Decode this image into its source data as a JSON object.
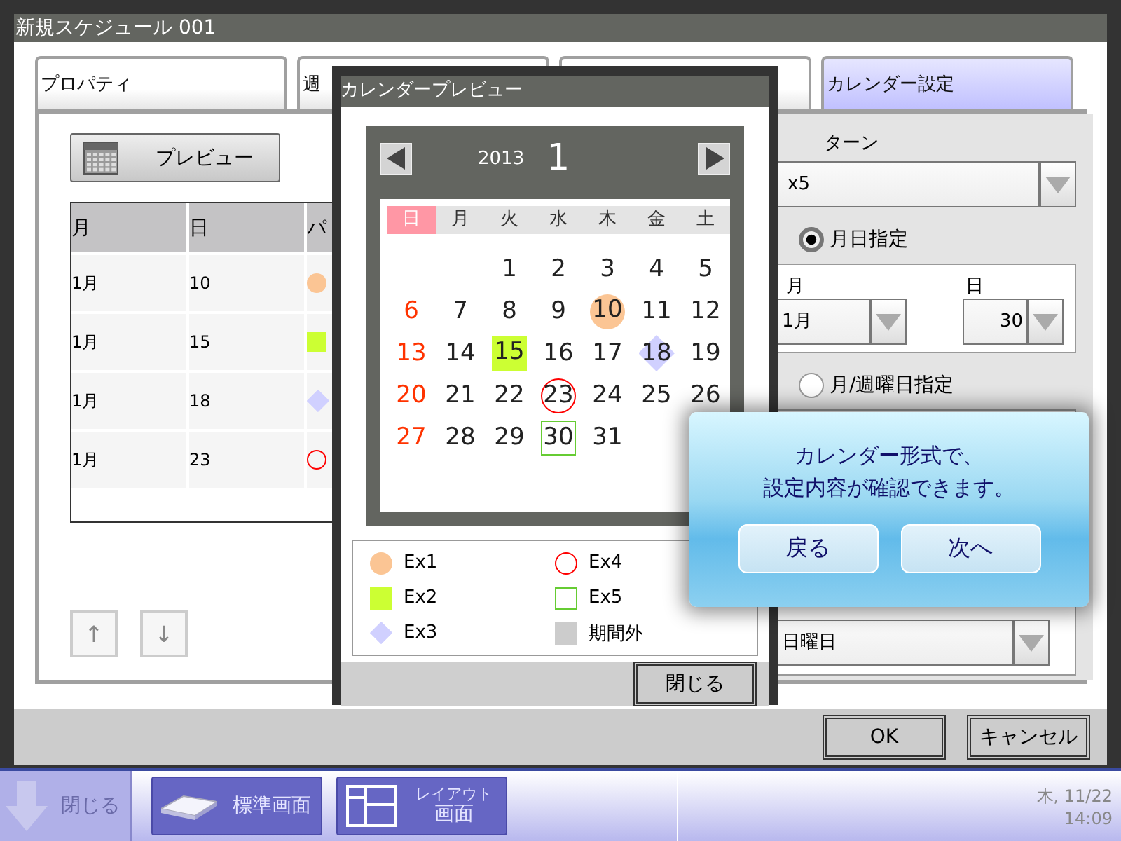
{
  "window": {
    "title": "新規スケジュール 001"
  },
  "tabs": [
    {
      "label": "プロパティ",
      "selected": false
    },
    {
      "label": "週",
      "selected": false
    },
    {
      "selected": false
    },
    {
      "label": "カレンダー設定",
      "selected": true
    }
  ],
  "preview_button": {
    "label": "プレビュー"
  },
  "table": {
    "columns": [
      "月",
      "日",
      "パ"
    ],
    "rows": [
      {
        "month": "1月",
        "day": "10",
        "mark": {
          "kind": "circle",
          "color": "#fbc594"
        }
      },
      {
        "month": "1月",
        "day": "15",
        "mark": {
          "kind": "square",
          "color": "#ccff33"
        }
      },
      {
        "month": "1月",
        "day": "18",
        "mark": {
          "kind": "diamond",
          "color": "#d0d0ff"
        }
      },
      {
        "month": "1月",
        "day": "23",
        "mark": {
          "kind": "ring",
          "color": "#ff0000"
        }
      }
    ]
  },
  "move_buttons": [
    {
      "label": "↑",
      "disabled": true
    },
    {
      "label": "↓",
      "disabled": true
    }
  ],
  "settings": {
    "pattern_label": "ターン",
    "pattern_value": "x5",
    "radios": [
      {
        "label": "月日指定",
        "selected": true
      },
      {
        "label": "月/週曜日指定",
        "selected": false
      }
    ],
    "date_fields": [
      {
        "label": "月",
        "value": "1月"
      },
      {
        "label": "日",
        "value": "30"
      }
    ],
    "weekday_value": "日曜日"
  },
  "buttons": [
    {
      "label": "OK"
    },
    {
      "label": "キャンセル"
    }
  ],
  "dialog": {
    "title": "カレンダープレビュー",
    "year": "2013",
    "month": "1",
    "weekdays": [
      "日",
      "月",
      "火",
      "水",
      "木",
      "金",
      "土"
    ],
    "weeks": [
      {
        "kind": "first",
        "days": [
          {
            "text": "1"
          },
          {
            "text": "2"
          },
          {
            "text": "3"
          },
          {
            "text": "4"
          },
          {
            "text": "5"
          }
        ]
      },
      {
        "kind": "full",
        "days": [
          {
            "text": "6"
          },
          {
            "text": "7"
          },
          {
            "text": "8"
          },
          {
            "text": "9"
          },
          {
            "text": "10",
            "mark": {
              "kind": "circle",
              "color": "#fbc594"
            }
          },
          {
            "text": "11"
          },
          {
            "text": "12"
          }
        ]
      },
      {
        "kind": "full",
        "days": [
          {
            "text": "13"
          },
          {
            "text": "14"
          },
          {
            "text": "15",
            "mark": {
              "kind": "square",
              "color": "#ccff33"
            }
          },
          {
            "text": "16"
          },
          {
            "text": "17"
          },
          {
            "text": "18",
            "mark": {
              "kind": "diamond",
              "color": "#d0d0ff"
            }
          },
          {
            "text": "19"
          }
        ]
      },
      {
        "kind": "full",
        "days": [
          {
            "text": "20"
          },
          {
            "text": "21"
          },
          {
            "text": "22"
          },
          {
            "text": "23",
            "mark": {
              "kind": "ring",
              "color": "#ff0000"
            }
          },
          {
            "text": "24"
          },
          {
            "text": "25"
          },
          {
            "text": "26"
          }
        ]
      },
      {
        "kind": "last",
        "days": [
          {
            "text": "27"
          },
          {
            "text": "28"
          },
          {
            "text": "29"
          },
          {
            "text": "30",
            "mark": {
              "kind": "box",
              "color": "#66cc33"
            }
          },
          {
            "text": "31"
          }
        ]
      }
    ],
    "legend": [
      {
        "label": "Ex1",
        "mark": {
          "kind": "circle",
          "color": "#fbc594"
        }
      },
      {
        "label": "Ex4",
        "mark": {
          "kind": "ring",
          "color": "#ff0000"
        }
      },
      {
        "label": "Ex2",
        "mark": {
          "kind": "square",
          "color": "#ccff33"
        }
      },
      {
        "label": "Ex5",
        "mark": {
          "kind": "box",
          "color": "#66cc33"
        }
      },
      {
        "label": "Ex3",
        "mark": {
          "kind": "diamond",
          "color": "#d0d0ff"
        }
      },
      {
        "label": "期間外",
        "mark": {
          "kind": "block",
          "color": "#cccccc"
        }
      }
    ],
    "close_button": {
      "label": "閉じる"
    }
  },
  "balloon": {
    "message_lines": [
      "カレンダー形式で、",
      "設定内容が確認できます。"
    ],
    "buttons": [
      {
        "label": "戻る"
      },
      {
        "label": "次へ"
      }
    ]
  },
  "taskbar": {
    "items": [
      {
        "label": "閉じる",
        "disabled": true,
        "kind": "close"
      },
      {
        "label": "標準画面",
        "disabled": false,
        "kind": "standard"
      },
      {
        "label": "レイアウト",
        "sublabel": "画面",
        "disabled": false,
        "kind": "layout"
      }
    ],
    "day": "木, 11/22",
    "time": "14:09"
  }
}
